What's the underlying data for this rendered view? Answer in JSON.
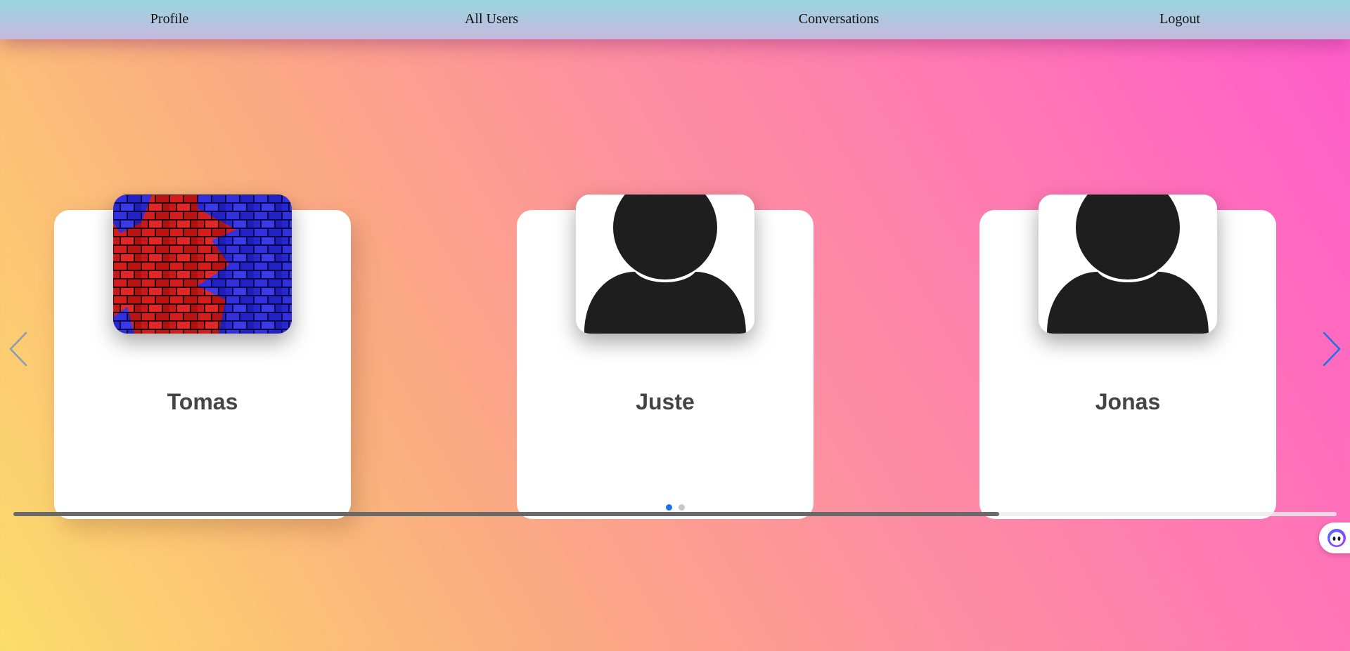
{
  "nav": {
    "profile": "Profile",
    "all_users": "All Users",
    "conversations": "Conversations",
    "logout": "Logout"
  },
  "users": [
    {
      "name": "Tomas",
      "avatar": "brick-wall-photo"
    },
    {
      "name": "Juste",
      "avatar": "default-person-icon"
    },
    {
      "name": "Jonas",
      "avatar": "default-person-icon"
    }
  ],
  "carousel": {
    "prev_icon": "chevron-left-icon",
    "next_icon": "chevron-right-icon",
    "page_count": 2,
    "active_page": 1,
    "scroll_fraction": 0.745
  },
  "colors": {
    "accent": "#1a73e8",
    "arrow_disabled": "#8a9bb3",
    "dot_inactive": "#c8c8c8",
    "navbar_top": "#99d6e0",
    "navbar_bottom": "#c6b8dc"
  },
  "widget": {
    "icon": "assistant-face-icon"
  }
}
